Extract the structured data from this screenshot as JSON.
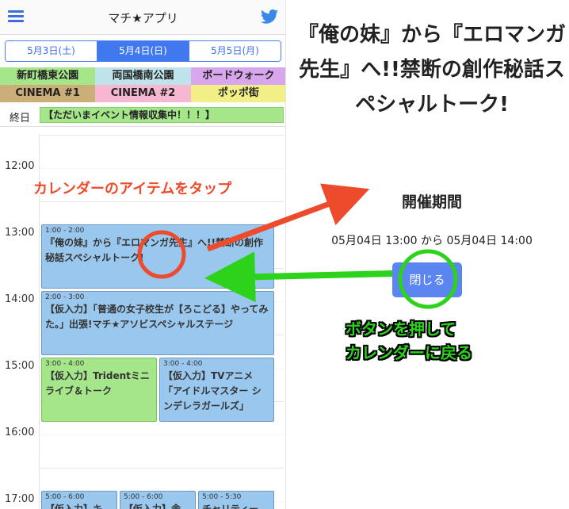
{
  "app": {
    "title": "マチ★アプリ",
    "icons": {
      "menu": "hamburger-icon",
      "share": "twitter-icon"
    }
  },
  "date_tabs": [
    {
      "label": "5月3日(土)",
      "active": false
    },
    {
      "label": "5月4日(日)",
      "active": true
    },
    {
      "label": "5月5日(月)",
      "active": false
    }
  ],
  "venues": [
    {
      "label": "新町橋東公園",
      "color": "#a6e68b"
    },
    {
      "label": "両国橋南公園",
      "color": "#bfe3ea"
    },
    {
      "label": "ボードウォーク",
      "color": "#d7a6ec"
    },
    {
      "label": "CINEMA #1",
      "color": "#cbae78"
    },
    {
      "label": "CINEMA #2",
      "color": "#f7b7d3"
    },
    {
      "label": "ポッポ街",
      "color": "#f1ef86"
    }
  ],
  "all_day": {
    "label": "終日",
    "event": "【ただいまイベント情報収集中！！！】"
  },
  "timeline": {
    "hours": [
      "12:00",
      "13:00",
      "14:00",
      "15:00",
      "16:00",
      "17:00"
    ]
  },
  "events": [
    {
      "time": "1:00 - 2:00",
      "name": "『俺の妹』から『エロマンガ先生』へ!!禁断の創作秘話スペシャルトーク!",
      "color": "blue"
    },
    {
      "time": "2:00 - 3:00",
      "name": "【仮入力】「普通の女子校生が【ろこどる】やってみた。」出張!マチ★アソビスペシャルステージ",
      "color": "blue"
    },
    {
      "time": "3:00 - 4:00",
      "name": "【仮入力】Tridentミニライブ＆トーク",
      "color": "green"
    },
    {
      "time": "3:00 - 4:00",
      "name": "【仮入力】TVアニメ「アイドルマスター シンデレラガールズ」",
      "color": "blue"
    },
    {
      "time": "5:00 - 6:00",
      "name": "【仮入力】キ",
      "color": "blue"
    },
    {
      "time": "5:00 - 6:00",
      "name": "【仮入力】舎",
      "color": "blue"
    },
    {
      "time": "5:00 - 5:30",
      "name": "チャリティー",
      "color": "blue"
    }
  ],
  "detail": {
    "title": "『俺の妹』から『エロマンガ先生』へ!!禁断の創作秘話スペシャルトーク!",
    "period_label": "開催期間",
    "period": "05月04日 13:00 から 05月04日 14:00",
    "close_label": "閉じる"
  },
  "annotations": {
    "tap_hint": "カレンダーのアイテムをタップ",
    "back_hint_line1": "ボタンを押して",
    "back_hint_line2": "カレンダーに戻る",
    "colors": {
      "red": "#ee4a2c",
      "green": "#2dd21b"
    }
  }
}
